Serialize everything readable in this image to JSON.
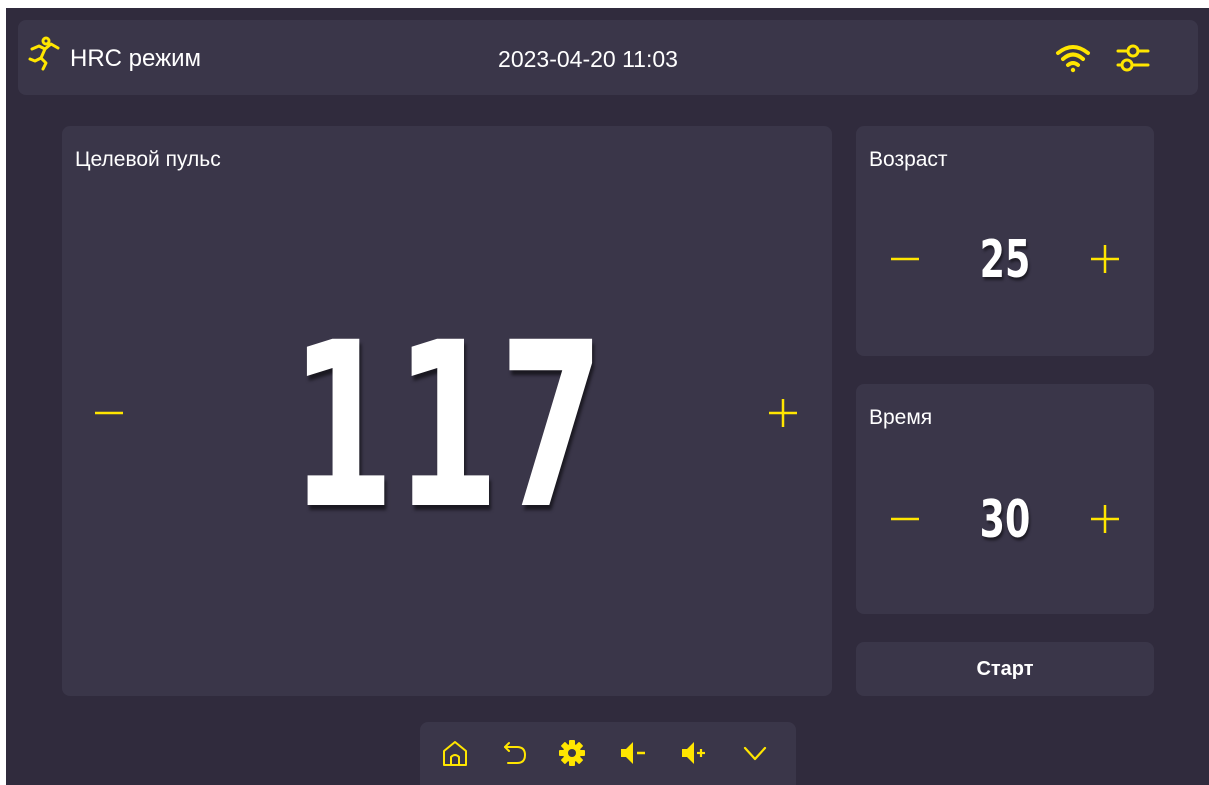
{
  "header": {
    "mode_icon": "running-person-icon",
    "mode_title": "HRC режим",
    "datetime": "2023-04-20 11:03",
    "wifi_icon": "wifi-icon",
    "settings_icon": "sliders-icon"
  },
  "target_pulse": {
    "title": "Целевой пульс",
    "value": "117"
  },
  "age": {
    "title": "Возраст",
    "value": "25"
  },
  "time": {
    "title": "Время",
    "value": "30"
  },
  "start_label": "Старт",
  "navbar": {
    "items": [
      "home-icon",
      "back-icon",
      "gear-icon",
      "volume-down-icon",
      "volume-up-icon",
      "chevron-down-icon"
    ]
  },
  "colors": {
    "accent": "#ffe600",
    "background": "#302b3d",
    "panel": "#3a3649",
    "text": "#ffffff"
  }
}
